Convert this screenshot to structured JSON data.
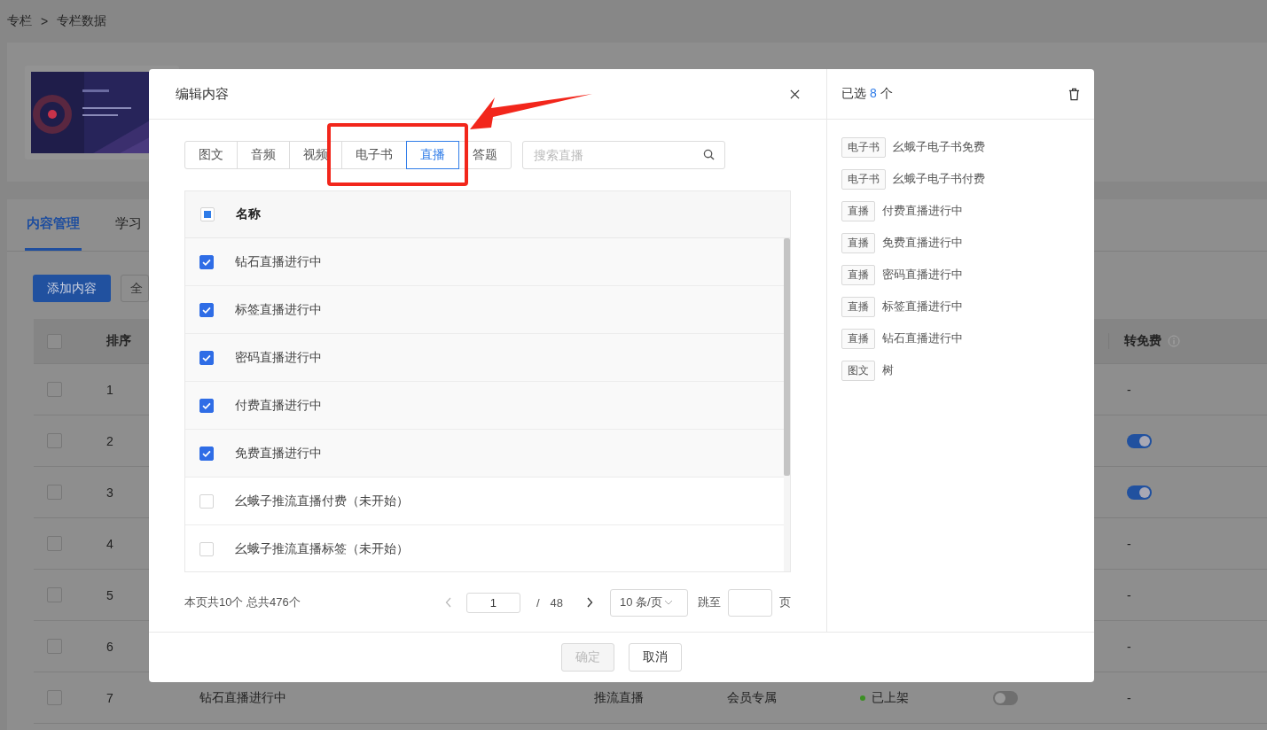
{
  "breadcrumb": {
    "items": [
      "专栏",
      "专栏数据"
    ],
    "separator": ">"
  },
  "page_tabs": [
    {
      "label": "内容管理",
      "selected": true
    },
    {
      "label": "学习",
      "selected": false
    }
  ],
  "toolbar": {
    "add_button": "添加内容",
    "filter_button": "全"
  },
  "content_table": {
    "columns": {
      "column_2": "排序",
      "column_last": "转免费"
    },
    "header_checked": false,
    "rows": [
      {
        "index": "1",
        "checked": false,
        "free": {
          "kind": "text",
          "text": "-"
        }
      },
      {
        "index": "2",
        "checked": false,
        "free": {
          "kind": "switch",
          "on": true
        }
      },
      {
        "index": "3",
        "checked": false,
        "free": {
          "kind": "switch",
          "on": true
        }
      },
      {
        "index": "4",
        "checked": false,
        "free": {
          "kind": "text",
          "text": "-"
        }
      },
      {
        "index": "5",
        "checked": false,
        "free": {
          "kind": "text",
          "text": "-"
        }
      },
      {
        "index": "6",
        "checked": false,
        "free": {
          "kind": "text",
          "text": "-"
        }
      },
      {
        "index": "7",
        "checked": false,
        "name": "钻石直播进行中",
        "type": "推流直播",
        "access": "会员专属",
        "status": {
          "label": "已上架",
          "color": "#3c8f24"
        },
        "switch_on": false,
        "free": {
          "kind": "text",
          "text": "-"
        }
      }
    ]
  },
  "dialog": {
    "title": "编辑内容",
    "type_tabs": [
      {
        "label": "图文",
        "selected": false
      },
      {
        "label": "音频",
        "selected": false
      },
      {
        "label": "视频",
        "selected": false
      },
      {
        "label": "电子书",
        "selected": false
      },
      {
        "label": "直播",
        "selected": true
      },
      {
        "label": "答题",
        "selected": false
      }
    ],
    "search": {
      "placeholder": "搜索直播"
    },
    "table": {
      "header": "名称",
      "header_indeterminate": true,
      "rows": [
        {
          "name": "钻石直播进行中",
          "checked": true
        },
        {
          "name": "标签直播进行中",
          "checked": true
        },
        {
          "name": "密码直播进行中",
          "checked": true
        },
        {
          "name": "付费直播进行中",
          "checked": true
        },
        {
          "name": "免费直播进行中",
          "checked": true
        },
        {
          "name": "幺蛾子推流直播付费（未开始）",
          "checked": false
        },
        {
          "name": "幺蛾子推流直播标签（未开始）",
          "checked": false
        }
      ]
    },
    "pagination": {
      "summary": "本页共10个 总共476个",
      "page": "1",
      "separator": "/",
      "total_pages": "48",
      "page_size": "10 条/页",
      "jump_label": "跳至",
      "jump_unit": "页"
    },
    "buttons": [
      {
        "label": "确定",
        "disabled": true
      },
      {
        "label": "取消",
        "disabled": false
      }
    ],
    "selected_panel": {
      "label": "已选",
      "count": "8",
      "unit": "个",
      "items": [
        {
          "tag": "电子书",
          "name": "幺蛾子电子书免费"
        },
        {
          "tag": "电子书",
          "name": "幺蛾子电子书付费"
        },
        {
          "tag": "直播",
          "name": "付费直播进行中"
        },
        {
          "tag": "直播",
          "name": "免费直播进行中"
        },
        {
          "tag": "直播",
          "name": "密码直播进行中"
        },
        {
          "tag": "直播",
          "name": "标签直播进行中"
        },
        {
          "tag": "直播",
          "name": "钻石直播进行中"
        },
        {
          "tag": "图文",
          "name": "树"
        }
      ]
    }
  }
}
